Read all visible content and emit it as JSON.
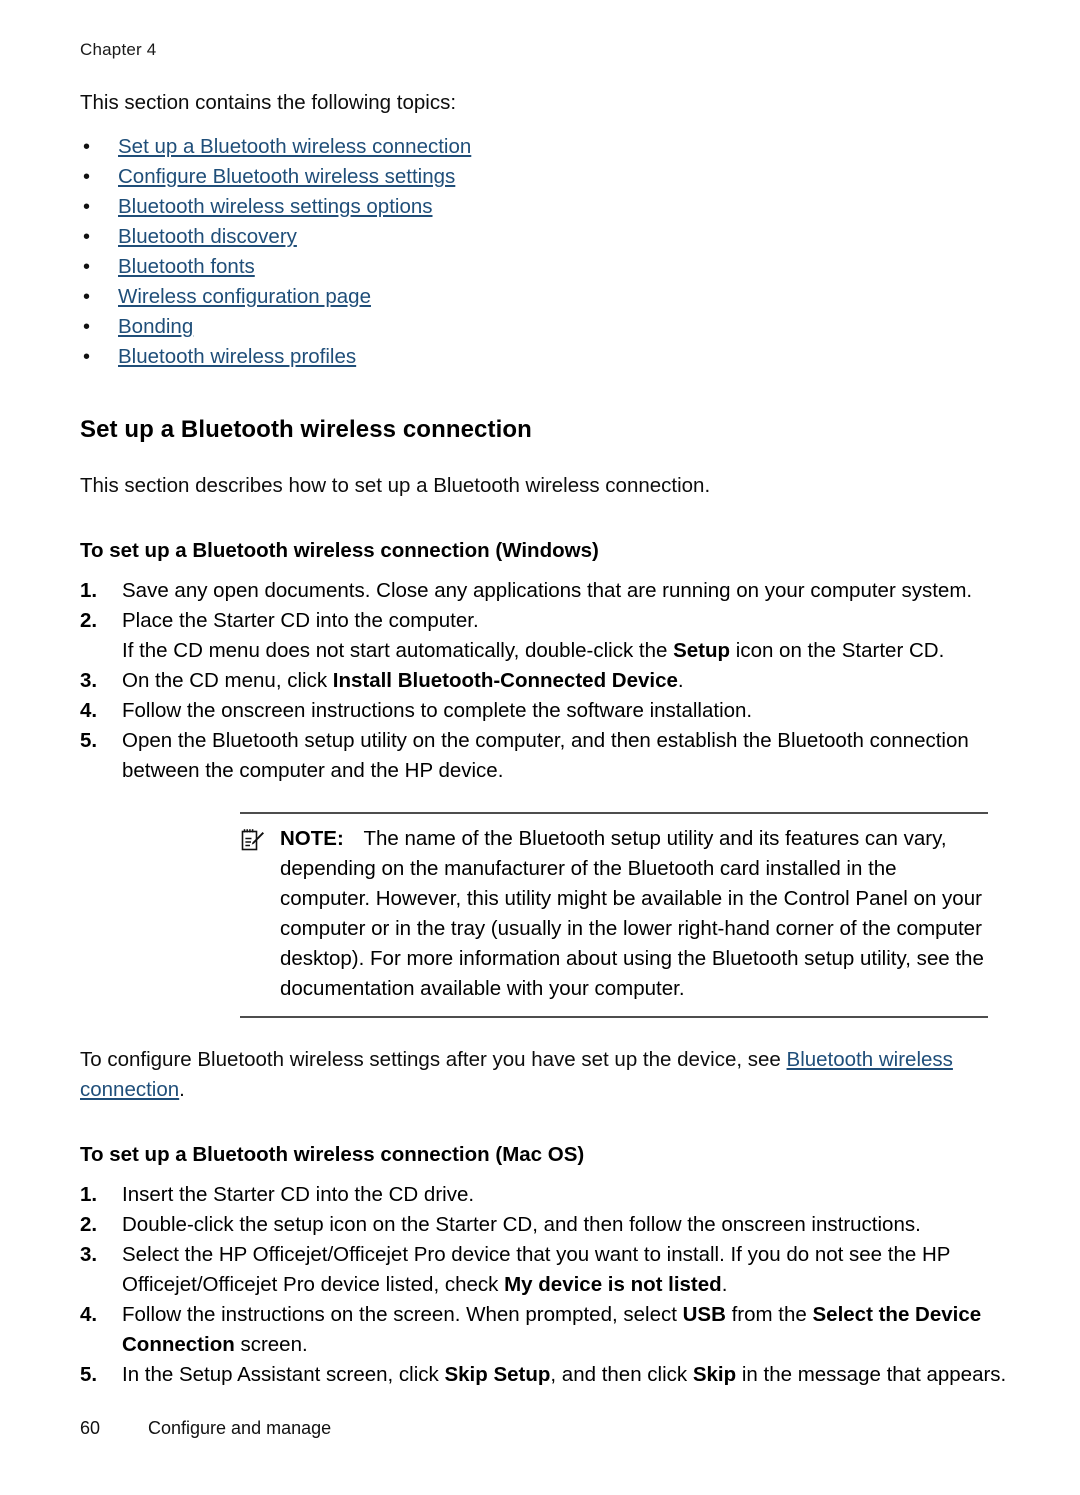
{
  "header": {
    "chapter": "Chapter 4"
  },
  "intro": {
    "lead": "This section contains the following topics:"
  },
  "topics": {
    "bullet_glyph": "•",
    "items": [
      {
        "label": "Set up a Bluetooth wireless connection"
      },
      {
        "label": "Configure Bluetooth wireless settings"
      },
      {
        "label": "Bluetooth wireless settings options"
      },
      {
        "label": "Bluetooth discovery"
      },
      {
        "label": "Bluetooth fonts"
      },
      {
        "label": "Wireless configuration page"
      },
      {
        "label": "Bonding"
      },
      {
        "label": "Bluetooth wireless profiles"
      }
    ]
  },
  "section": {
    "heading": "Set up a Bluetooth wireless connection",
    "description": "This section describes how to set up a Bluetooth wireless connection."
  },
  "windows_procedure": {
    "heading": "To set up a Bluetooth wireless connection (Windows)",
    "steps": [
      {
        "num": "1.",
        "text": "Save any open documents. Close any applications that are running on your computer system."
      },
      {
        "num": "2.",
        "text": "Place the Starter CD into the computer.",
        "sub_pre": "If the CD menu does not start automatically, double-click the ",
        "sub_bold": "Setup",
        "sub_post": " icon on the Starter CD."
      },
      {
        "num": "3.",
        "pre": "On the CD menu, click ",
        "bold": "Install Bluetooth-Connected Device",
        "post": "."
      },
      {
        "num": "4.",
        "text": "Follow the onscreen instructions to complete the software installation."
      },
      {
        "num": "5.",
        "text": "Open the Bluetooth setup utility on the computer, and then establish the Bluetooth connection between the computer and the HP device."
      }
    ]
  },
  "note": {
    "icon": "note-pencil-icon",
    "label": "NOTE:",
    "text": "The name of the Bluetooth setup utility and its features can vary, depending on the manufacturer of the Bluetooth card installed in the computer. However, this utility might be available in the Control Panel on your computer or in the tray (usually in the lower right-hand corner of the computer desktop). For more information about using the Bluetooth setup utility, see the documentation available with your computer."
  },
  "after_note": {
    "pre": "To configure Bluetooth wireless settings after you have set up the device, see ",
    "link": "Bluetooth wireless connection",
    "post": "."
  },
  "mac_procedure": {
    "heading": "To set up a Bluetooth wireless connection (Mac OS)",
    "steps": [
      {
        "num": "1.",
        "text": "Insert the Starter CD into the CD drive."
      },
      {
        "num": "2.",
        "text": "Double-click the setup icon on the Starter CD, and then follow the onscreen instructions."
      },
      {
        "num": "3.",
        "pre": "Select the HP Officejet/Officejet Pro device that you want to install. If you do not see the HP Officejet/Officejet Pro device listed, check ",
        "bold": "My device is not listed",
        "post": "."
      },
      {
        "num": "4.",
        "pre": "Follow the instructions on the screen. When prompted, select ",
        "bold": "USB",
        "mid": " from the ",
        "bold2": "Select the Device Connection",
        "post": " screen."
      },
      {
        "num": "5.",
        "pre": "In the Setup Assistant screen, click ",
        "bold": "Skip Setup",
        "mid": ", and then click ",
        "bold2": "Skip",
        "post": " in the message that appears."
      }
    ]
  },
  "footer": {
    "page_number": "60",
    "section_title": "Configure and manage"
  },
  "colors": {
    "link": "#1f4e79",
    "rule": "#4d4d4d",
    "text": "#0d0d0d"
  }
}
